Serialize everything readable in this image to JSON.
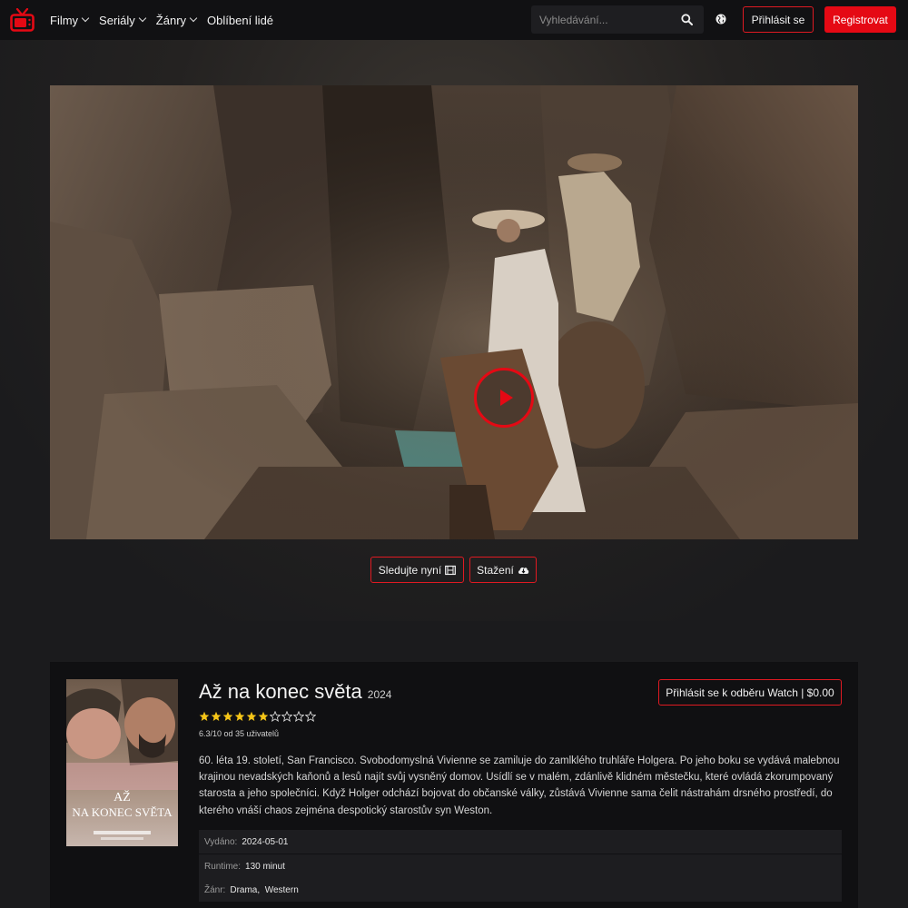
{
  "nav": {
    "menu": [
      {
        "label": "Filmy",
        "has_dropdown": true
      },
      {
        "label": "Seriály",
        "has_dropdown": true
      },
      {
        "label": "Žánry",
        "has_dropdown": true
      },
      {
        "label": "Oblíbení lidé",
        "has_dropdown": false
      }
    ],
    "search_placeholder": "Vyhledávání...",
    "login_label": "Přihlásit se",
    "register_label": "Registrovat"
  },
  "hero": {
    "watch_label": "Sledujte nyní",
    "download_label": "Stažení"
  },
  "movie": {
    "title": "Až na konec světa",
    "year": "2024",
    "rating_stars": 6.3,
    "rating_max_stars": 10,
    "rating_text": "6.3/10 od 35 uživatelů",
    "subscribe_label": "Přihlásit se k odběru Watch | $0.00",
    "description": "60. léta 19. století, San Francisco. Svobodomyslná Vivienne se zamiluje do zamlklého truhláře Holgera. Po jeho boku se vydává malebnou krajinou nevadských kaňonů a lesů najít svůj vysněný domov. Usídlí se v malém, zdánlivě klidném městečku, které ovládá zkorumpovaný starosta a jeho společníci. Když Holger odchází bojovat do občanské války, zůstává Vivienne sama čelit nástrahám drsného prostředí, do kterého vnáší chaos zejména despotický starostův syn Weston.",
    "released_label": "Vydáno:",
    "released_value": "2024-05-01",
    "runtime_label": "Runtime:",
    "runtime_value": "130 minut",
    "genre_label": "Žánr:",
    "genres": [
      "Drama",
      "Western"
    ]
  },
  "poster_text": {
    "title_line1": "AŽ",
    "title_line2": "NA KONEC SVĚTA"
  },
  "colors": {
    "accent": "#e50914",
    "star": "#f5c518",
    "card_bg": "#101012",
    "page_bg": "#1b1b1d"
  },
  "icons": {
    "logo": "tv-icon",
    "search": "search-icon",
    "language": "globe-icon",
    "watch": "film-icon",
    "download": "cloud-download-icon",
    "play": "play-icon"
  }
}
